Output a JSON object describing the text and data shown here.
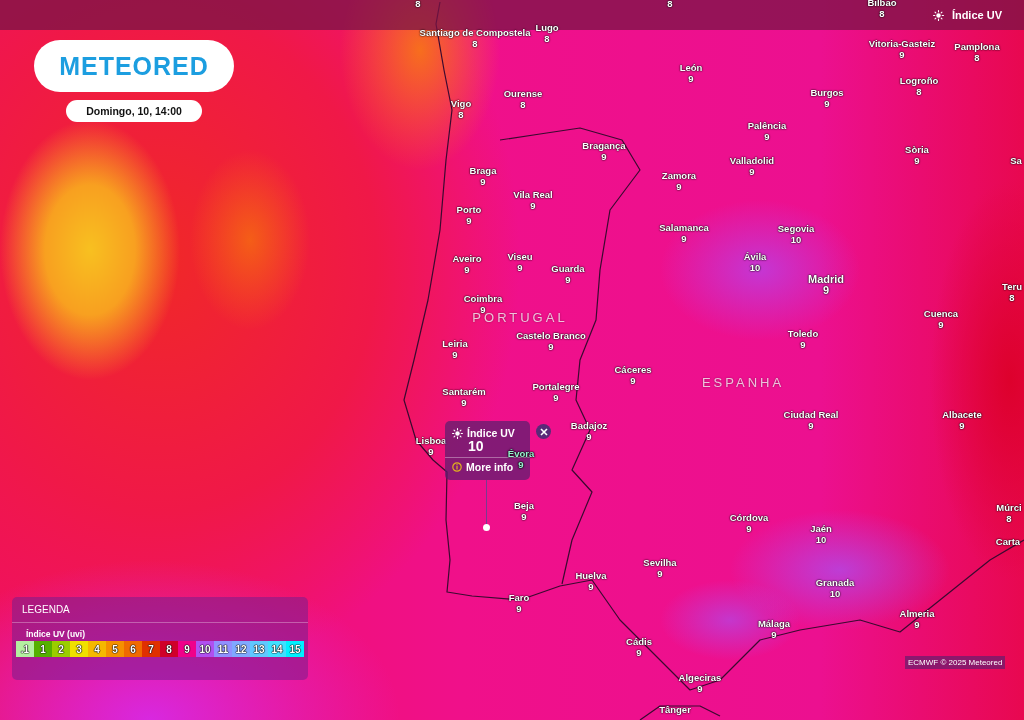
{
  "header": {
    "layer_label": "Índice UV"
  },
  "logo": {
    "text": "METEORED"
  },
  "date_label": "Domingo, 10, 14:00",
  "map": {
    "country_labels": [
      "PORTUGAL",
      "ESPANHA"
    ],
    "cities": [
      {
        "value": "8"
      },
      {
        "value": "8"
      },
      {
        "name": "Bilbao",
        "value": "8"
      },
      {
        "name": "Santiago de Compostela",
        "value": "8"
      },
      {
        "name": "Lugo",
        "value": "8"
      },
      {
        "name": "Vitoria-Gasteiz",
        "value": "9"
      },
      {
        "name": "Pamplona",
        "value": "8"
      },
      {
        "name": "León",
        "value": "9"
      },
      {
        "name": "Logroño",
        "value": "8"
      },
      {
        "name": "Ourense",
        "value": "8"
      },
      {
        "name": "Burgos",
        "value": "9"
      },
      {
        "name": "Vigo",
        "value": "8"
      },
      {
        "name": "Palência",
        "value": "9"
      },
      {
        "name": "Bragança",
        "value": "9"
      },
      {
        "name": "Sòria",
        "value": "9"
      },
      {
        "name": "Valladolid",
        "value": "9"
      },
      {
        "name": "Sa"
      },
      {
        "name": "Braga",
        "value": "9"
      },
      {
        "name": "Zamora",
        "value": "9"
      },
      {
        "name": "Vila Real",
        "value": "9"
      },
      {
        "name": "Porto",
        "value": "9"
      },
      {
        "name": "Salamanca",
        "value": "9"
      },
      {
        "name": "Segovia",
        "value": "10"
      },
      {
        "name": "Aveiro",
        "value": "9"
      },
      {
        "name": "Viseu",
        "value": "9"
      },
      {
        "name": "Ávila",
        "value": "10"
      },
      {
        "name": "Guarda",
        "value": "9"
      },
      {
        "name": "Madrid",
        "value": "9"
      },
      {
        "name": "Teru",
        "value": "8"
      },
      {
        "name": "Coimbra",
        "value": "9"
      },
      {
        "name": "Cuenca",
        "value": "9"
      },
      {
        "name": "Castelo Branco",
        "value": "9"
      },
      {
        "name": "Toledo",
        "value": "9"
      },
      {
        "name": "Leiria",
        "value": "9"
      },
      {
        "name": "Cáceres",
        "value": "9"
      },
      {
        "name": "Portalegre",
        "value": "9"
      },
      {
        "name": "Santarém",
        "value": "9"
      },
      {
        "name": "Ciudad Real",
        "value": "9"
      },
      {
        "name": "Albacete",
        "value": "9"
      },
      {
        "name": "Badajoz",
        "value": "9"
      },
      {
        "name": "Lisboa",
        "value": "9"
      },
      {
        "name": "Évora",
        "value": "9"
      },
      {
        "name": "Beja",
        "value": "9"
      },
      {
        "name": "Múrci",
        "value": "8"
      },
      {
        "name": "Córdova",
        "value": "9"
      },
      {
        "name": "Jaén",
        "value": "10"
      },
      {
        "name": "Carta"
      },
      {
        "name": "Sevilha",
        "value": "9"
      },
      {
        "name": "Huelva",
        "value": "9"
      },
      {
        "name": "Granada",
        "value": "10"
      },
      {
        "name": "Faro",
        "value": "9"
      },
      {
        "name": "Almeria",
        "value": "9"
      },
      {
        "name": "Málaga",
        "value": "9"
      },
      {
        "name": "Cádis",
        "value": "9"
      },
      {
        "name": "Algeciras",
        "value": "9"
      },
      {
        "name": "Tânger"
      }
    ]
  },
  "popup": {
    "title": "Índice UV",
    "value": "10",
    "link": "More info"
  },
  "legend": {
    "title": "LEGENDA",
    "scale_label": "Índice UV (uvi)",
    "steps": [
      {
        "label": ".1",
        "color": "#b4f0a0"
      },
      {
        "label": "1",
        "color": "#55b000"
      },
      {
        "label": "2",
        "color": "#9acd00"
      },
      {
        "label": "3",
        "color": "#f0e000"
      },
      {
        "label": "4",
        "color": "#f5b800"
      },
      {
        "label": "5",
        "color": "#f59000"
      },
      {
        "label": "6",
        "color": "#f06a00"
      },
      {
        "label": "7",
        "color": "#e03000"
      },
      {
        "label": "8",
        "color": "#d0002a"
      },
      {
        "label": "9",
        "color": "#f0008a"
      },
      {
        "label": "10",
        "color": "#b050f0"
      },
      {
        "label": "11",
        "color": "#9090ff"
      },
      {
        "label": "12",
        "color": "#80a8ff"
      },
      {
        "label": "13",
        "color": "#60c8ff"
      },
      {
        "label": "14",
        "color": "#40e0ff"
      },
      {
        "label": "15",
        "color": "#00f0ff"
      }
    ]
  },
  "attribution": "ECMWF © 2025 Meteored"
}
